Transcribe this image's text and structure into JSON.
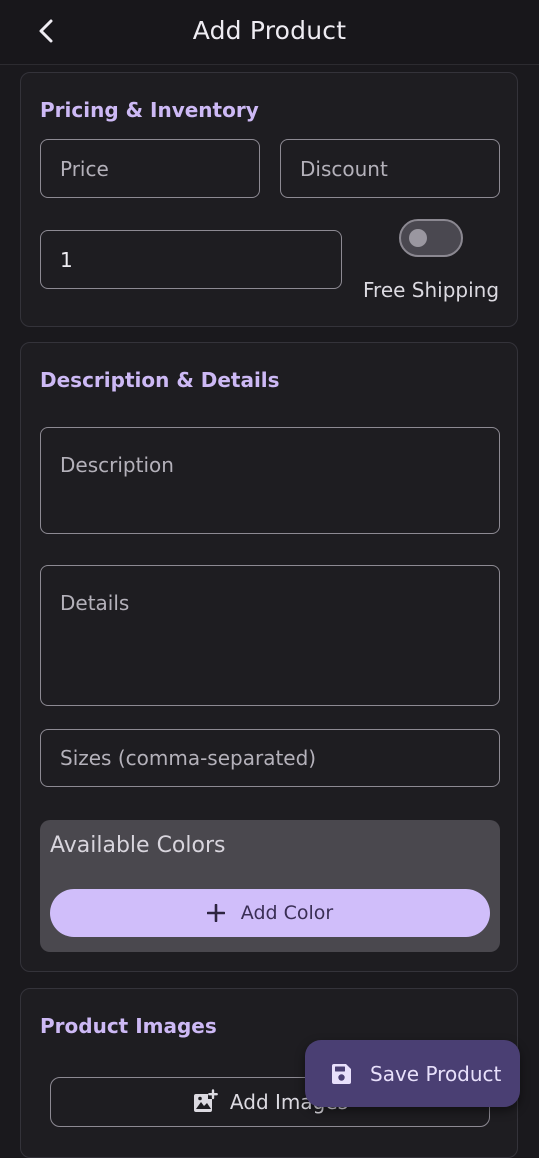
{
  "app_bar": {
    "title": "Add Product",
    "back_icon": "chevron-left-icon"
  },
  "pricing_section": {
    "title": "Pricing & Inventory",
    "price_placeholder": "Price",
    "discount_placeholder": "Discount",
    "quantity_value": "1",
    "free_shipping_label": "Free Shipping",
    "free_shipping_enabled": false
  },
  "description_section": {
    "title": "Description & Details",
    "description_placeholder": "Description",
    "details_placeholder": "Details",
    "sizes_placeholder": "Sizes (comma-separated)",
    "colors_label": "Available Colors",
    "add_color_label": "Add Color",
    "add_color_icon": "plus-icon"
  },
  "images_section": {
    "title": "Product Images",
    "add_images_label": "Add Images",
    "add_images_icon": "add-photo-icon"
  },
  "fab": {
    "label": "Save Product",
    "icon": "save-icon"
  },
  "colors": {
    "accent": "#cdb9f5",
    "button_bg": "#d0befa",
    "fab_bg": "#4a3f73",
    "background": "#1a191d"
  }
}
